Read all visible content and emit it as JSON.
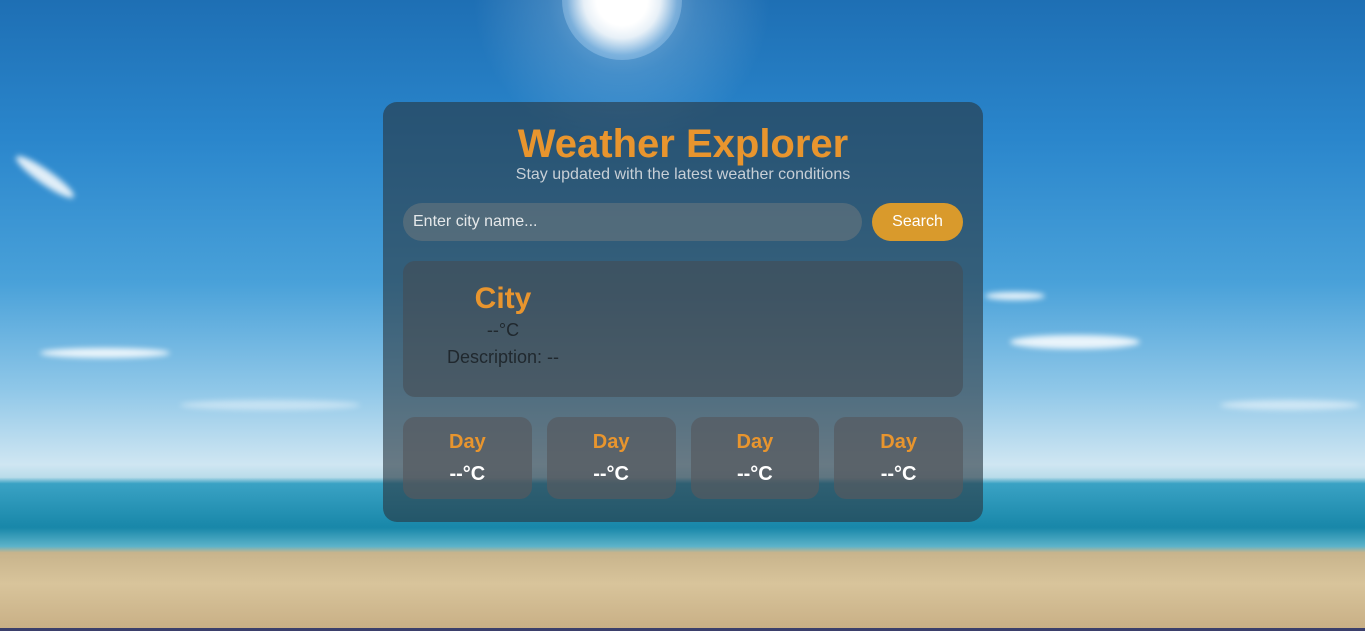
{
  "app": {
    "title": "Weather Explorer",
    "subtitle": "Stay updated with the latest weather conditions"
  },
  "search": {
    "placeholder": "Enter city name...",
    "value": "",
    "button_label": "Search"
  },
  "current": {
    "city": "City",
    "temperature": "--°C",
    "description": "Description: --"
  },
  "forecast": [
    {
      "day": "Day",
      "temperature": "--°C"
    },
    {
      "day": "Day",
      "temperature": "--°C"
    },
    {
      "day": "Day",
      "temperature": "--°C"
    },
    {
      "day": "Day",
      "temperature": "--°C"
    }
  ],
  "colors": {
    "accent": "#e8952e",
    "button": "#d99a2c"
  }
}
